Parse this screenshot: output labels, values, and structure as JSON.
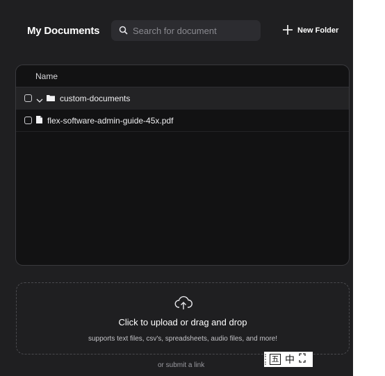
{
  "header": {
    "title": "My Documents",
    "search_placeholder": "Search for document",
    "new_folder_label": "New Folder"
  },
  "table": {
    "column_name": "Name",
    "rows": [
      {
        "type": "folder",
        "name": "custom-documents"
      },
      {
        "type": "file",
        "name": "flex-software-admin-guide-45x.pdf"
      }
    ]
  },
  "upload": {
    "title": "Click to upload or drag and drop",
    "subtitle": "supports text files, csv's, spreadsheets, audio files, and more!",
    "link_text": "or submit a link"
  },
  "ime_toolbar": {
    "mode_char": "中",
    "layout_char": "五"
  },
  "colors": {
    "panel_bg": "#1f1f21",
    "table_bg": "#121213",
    "search_bg": "#2c2c30"
  }
}
